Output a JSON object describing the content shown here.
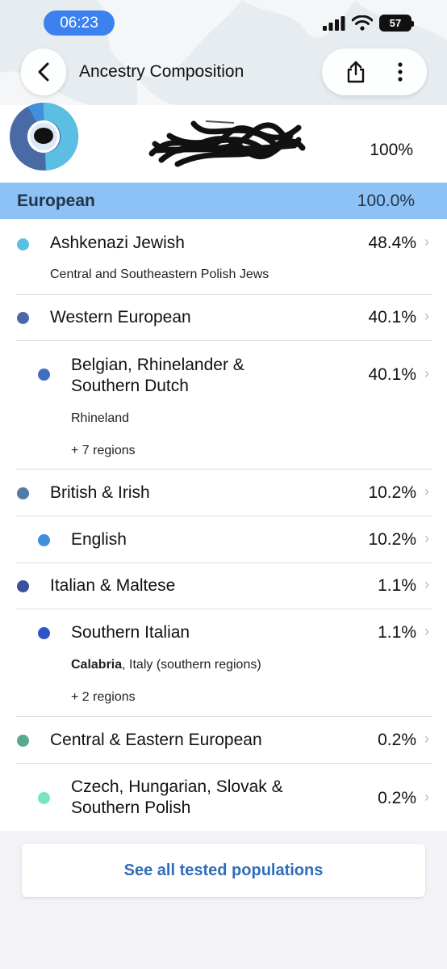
{
  "status_bar": {
    "time": "06:23",
    "battery": "57"
  },
  "nav": {
    "title": "Ancestry Composition"
  },
  "summary": {
    "percent": "100%"
  },
  "region": {
    "name": "European",
    "percent": "100.0%"
  },
  "populations": [
    {
      "name": "Ashkenazi Jewish",
      "percent": "48.4%",
      "detail": "Central and Southeastern Polish Jews",
      "color": "#5bbfe3"
    },
    {
      "name": "Western European",
      "percent": "40.1%",
      "color": "#4a6aa6"
    },
    {
      "name_line1": "Belgian, Rhinelander &",
      "name_line2": "Southern Dutch",
      "percent": "40.1%",
      "detail": "Rhineland",
      "more": "+ 7 regions",
      "color": "#3f6fc2"
    },
    {
      "name": "British & Irish",
      "percent": "10.2%",
      "color": "#4f7ba8"
    },
    {
      "name": "English",
      "percent": "10.2%",
      "color": "#3f8fdf"
    },
    {
      "name": "Italian & Maltese",
      "percent": "1.1%",
      "color": "#3a4fa0"
    },
    {
      "name": "Southern Italian",
      "percent": "1.1%",
      "detail_bold": "Calabria",
      "detail_rest": ", Italy (southern regions)",
      "more": "+ 2 regions",
      "color": "#2f54c9"
    },
    {
      "name": "Central & Eastern European",
      "percent": "0.2%",
      "color": "#5aa88e"
    },
    {
      "name_line1": "Czech, Hungarian, Slovak &",
      "name_line2": "Southern Polish",
      "percent": "0.2%",
      "color": "#79e3c6"
    }
  ],
  "see_all": {
    "label": "See all tested populations"
  }
}
